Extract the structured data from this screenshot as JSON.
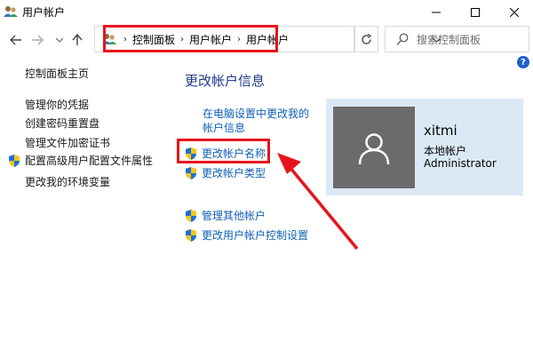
{
  "window": {
    "title": "用户帐户"
  },
  "address": {
    "crumbs": [
      "控制面板",
      "用户帐户",
      "用户帐户"
    ]
  },
  "search": {
    "placeholder": "搜索控制面板"
  },
  "help": {
    "label": "?"
  },
  "sidebar": {
    "items": [
      {
        "label": "控制面板主页",
        "shield": false
      },
      {
        "label": "管理你的凭据",
        "shield": false
      },
      {
        "label": "创建密码重置盘",
        "shield": false
      },
      {
        "label": "管理文件加密证书",
        "shield": false
      },
      {
        "label": "配置高级用户配置文件属性",
        "shield": true
      },
      {
        "label": "更改我的环境变量",
        "shield": false
      }
    ]
  },
  "main": {
    "heading": "更改帐户信息",
    "link_pc_settings_line1": "在电脑设置中更改我的",
    "link_pc_settings_line2": "帐户信息",
    "link_change_name": "更改帐户名称",
    "link_change_type": "更改帐户类型",
    "link_manage_other": "管理其他帐户",
    "link_uac": "更改用户帐户控制设置"
  },
  "user": {
    "name": "xitmi",
    "type": "本地帐户",
    "role": "Administrator"
  },
  "colors": {
    "accent_link": "#0f5fb5",
    "heading": "#1e3a8a",
    "highlight_red": "#e8141c",
    "card_bg": "#dbe9f7"
  }
}
